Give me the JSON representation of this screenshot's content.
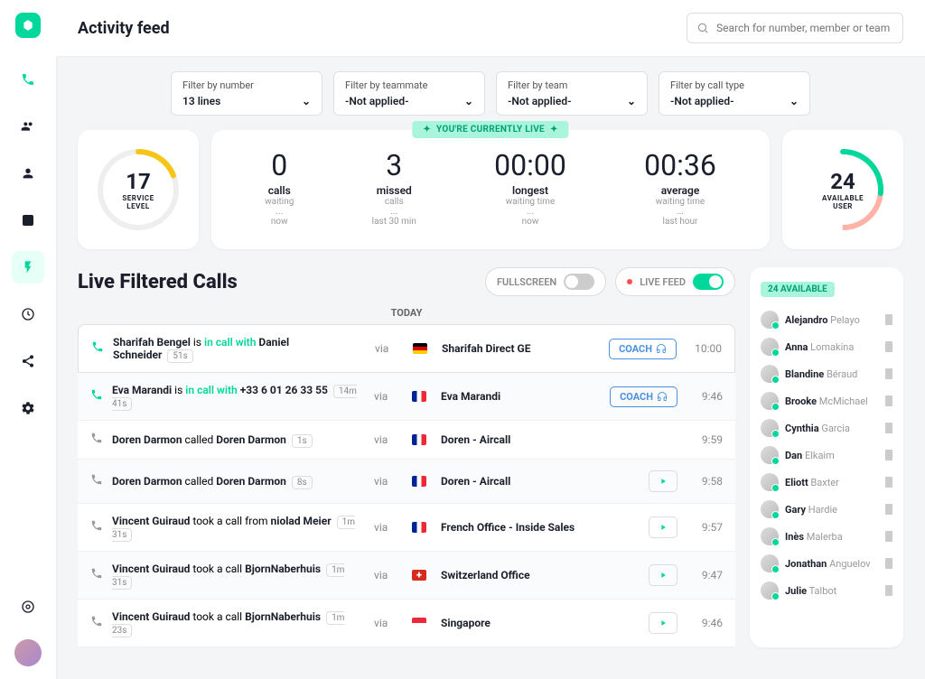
{
  "header": {
    "title": "Activity feed",
    "search_placeholder": "Search for number, member or team"
  },
  "filters": [
    {
      "label": "Filter by number",
      "value": "13 lines"
    },
    {
      "label": "Filter by teammate",
      "value": "-Not applied-"
    },
    {
      "label": "Filter by team",
      "value": "-Not applied-"
    },
    {
      "label": "Filter by call type",
      "value": "-Not applied-"
    }
  ],
  "live_banner": "YOU'RE CURRENTLY LIVE",
  "service_gauge": {
    "value": "17",
    "label": "SERVICE LEVEL"
  },
  "available_gauge": {
    "value": "24",
    "label": "AVAILABLE USER"
  },
  "metrics": [
    {
      "value": "0",
      "title": "calls",
      "sub1": "waiting",
      "sub2": "...",
      "sub3": "now"
    },
    {
      "value": "3",
      "title": "missed",
      "sub1": "calls",
      "sub2": "...",
      "sub3": "last 30 min"
    },
    {
      "value": "00:00",
      "title": "longest",
      "sub1": "waiting time",
      "sub2": "...",
      "sub3": "now"
    },
    {
      "value": "00:36",
      "title": "average",
      "sub1": "waiting time",
      "sub2": "...",
      "sub3": "last hour"
    }
  ],
  "calls_header": {
    "title": "Live Filtered Calls",
    "fullscreen": "FULLSCREEN",
    "livefeed": "LIVE FEED"
  },
  "today_label": "TODAY",
  "coach_label": "COACH",
  "via_label": "via",
  "calls": [
    {
      "icon": "in",
      "person1": "Sharifah Bengel",
      "verb": "is",
      "link": "in call with",
      "person2": "Daniel Schneider",
      "dur": "51s",
      "flag": "de",
      "callee": "Sharifah Direct GE",
      "action": "coach",
      "time": "10:00"
    },
    {
      "icon": "in",
      "person1": "Eva Marandi",
      "verb": "is",
      "link": "in call with",
      "person2": "+33 6 01 26 33 55",
      "dur": "14m 41s",
      "flag": "fr",
      "callee": "Eva Marandi",
      "action": "coach",
      "time": "9:46"
    },
    {
      "icon": "out",
      "person1": "Doren Darmon",
      "verb": "called",
      "link": "",
      "person2": "Doren Darmon",
      "dur": "1s",
      "flag": "fr",
      "callee": "Doren - Aircall",
      "action": "",
      "time": "9:59"
    },
    {
      "icon": "out",
      "person1": "Doren Darmon",
      "verb": "called",
      "link": "",
      "person2": "Doren Darmon",
      "dur": "8s",
      "flag": "fr",
      "callee": "Doren - Aircall",
      "action": "play",
      "time": "9:58"
    },
    {
      "icon": "out",
      "person1": "Vincent Guiraud",
      "verb": "took a call from",
      "link": "",
      "person2": "niolad Meier",
      "dur": "1m 31s",
      "flag": "fr",
      "callee": "French Office - Inside Sales",
      "action": "play",
      "time": "9:57"
    },
    {
      "icon": "out",
      "person1": "Vincent Guiraud",
      "verb": "took a call",
      "link": "",
      "person2": "BjornNaberhuis",
      "dur": "1m 31s",
      "flag": "ch",
      "callee": "Switzerland Office",
      "action": "play",
      "time": "9:47"
    },
    {
      "icon": "out",
      "person1": "Vincent Guiraud",
      "verb": "took a call",
      "link": "",
      "person2": "BjornNaberhuis",
      "dur": "1m 23s",
      "flag": "sg",
      "callee": "Singapore",
      "action": "play",
      "time": "9:46"
    }
  ],
  "available": {
    "badge": "24 AVAILABLE",
    "users": [
      {
        "first": "Alejandro",
        "last": "Pelayo"
      },
      {
        "first": "Anna",
        "last": "Lomakina"
      },
      {
        "first": "Blandine",
        "last": "Béraud"
      },
      {
        "first": "Brooke",
        "last": "McMichael"
      },
      {
        "first": "Cynthia",
        "last": "Garcia"
      },
      {
        "first": "Dan",
        "last": "Elkaim"
      },
      {
        "first": "Eliott",
        "last": "Baxter"
      },
      {
        "first": "Gary",
        "last": "Hardie"
      },
      {
        "first": "Inès",
        "last": "Malerba"
      },
      {
        "first": "Jonathan",
        "last": "Anguelov"
      },
      {
        "first": "Julie",
        "last": "Talbot"
      }
    ]
  }
}
